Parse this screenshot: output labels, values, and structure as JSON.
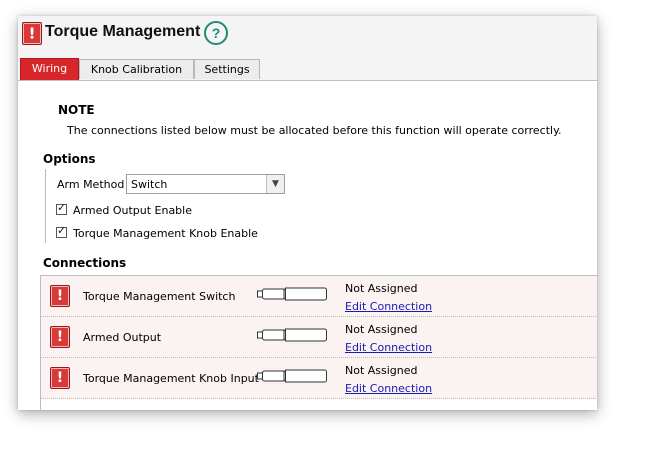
{
  "header": {
    "title": "Torque Management",
    "help_symbol": "?"
  },
  "tabs": [
    {
      "label": "Wiring",
      "active": true
    },
    {
      "label": "Knob Calibration",
      "active": false
    },
    {
      "label": "Settings",
      "active": false
    }
  ],
  "note": {
    "title": "NOTE",
    "text": "The connections listed below must be allocated before this function will operate correctly."
  },
  "options": {
    "heading": "Options",
    "arm_method": {
      "label": "Arm Method",
      "value": "Switch"
    },
    "checkboxes": [
      {
        "label": "Armed Output Enable",
        "checked": true
      },
      {
        "label": "Torque Management Knob Enable",
        "checked": true
      }
    ]
  },
  "connections": {
    "heading": "Connections",
    "rows": [
      {
        "name": "Torque Management Switch",
        "status": "Not Assigned",
        "action": "Edit Connection"
      },
      {
        "name": "Armed Output",
        "status": "Not Assigned",
        "action": "Edit Connection"
      },
      {
        "name": "Torque Management Knob Input",
        "status": "Not Assigned",
        "action": "Edit Connection"
      }
    ]
  },
  "colors": {
    "accent": "#d9262a",
    "warning": "#d83a3a",
    "help": "#1d8a7a",
    "link": "#1a1ab8"
  },
  "icons": {
    "warning": "exclamation-warning-icon",
    "connector": "cable-plug-icon",
    "dropdown": "chevron-down-icon"
  }
}
